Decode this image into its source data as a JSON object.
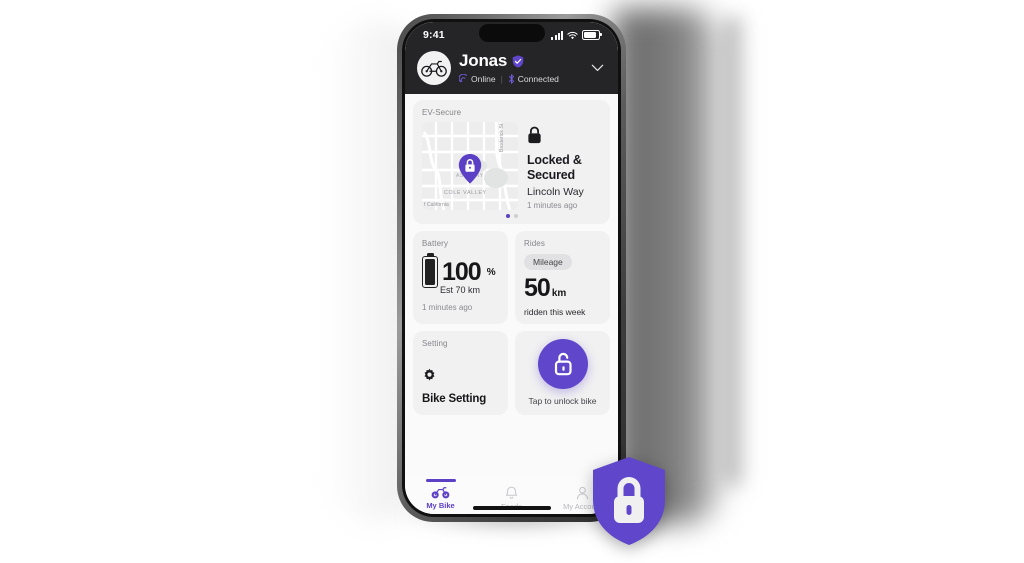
{
  "theme": {
    "accent": "#6046ca",
    "accent_dark": "#5b3fc4",
    "screen_bg": "#fafafa",
    "card_bg": "#f1f1f1",
    "header_bg": "#252528",
    "text_dark": "#17171a",
    "text_muted": "#8a8a90"
  },
  "status_bar": {
    "time": "9:41",
    "cellular_icon": "cellular-bars-icon",
    "wifi_icon": "wifi-icon",
    "battery_icon": "battery-icon"
  },
  "header": {
    "avatar_icon": "bicycle-avatar-icon",
    "user_name": "Jonas",
    "verified_icon": "verified-shield-icon",
    "connectivity": [
      {
        "icon": "signal-icon",
        "label": "Online"
      },
      {
        "icon": "bluetooth-icon",
        "label": "Connected"
      }
    ],
    "separator": "|",
    "chevron_icon": "chevron-down-icon"
  },
  "cards": {
    "map": {
      "label": "EV-Secure",
      "lock_icon": "padlock-closed-icon",
      "status_title": "Locked &\nSecured",
      "status_title_line1": "Locked &",
      "status_title_line2": "Secured",
      "street": "Lincoln Way",
      "updated": "1 minutes ago",
      "pin_icon": "map-pin-lock-icon",
      "map_labels": [
        "Broderick St",
        "COLE VALLEY",
        "ASHBURY",
        "f California"
      ],
      "carousel": {
        "total": 2,
        "active_index": 0
      }
    },
    "battery": {
      "label": "Battery",
      "battery_icon": "battery-full-icon",
      "value": "100",
      "unit": "%",
      "estimate": "Est 70 km",
      "updated": "1 minutes ago"
    },
    "rides": {
      "label": "Rides",
      "chip": "Mileage",
      "value": "50",
      "unit": "km",
      "caption": "ridden this week"
    },
    "setting": {
      "label": "Setting",
      "gear_icon": "gear-icon",
      "title": "Bike Setting"
    },
    "unlock": {
      "button_icon": "padlock-open-icon",
      "caption": "Tap to unlock bike"
    }
  },
  "tabbar": {
    "items": [
      {
        "icon": "bicycle-icon",
        "label": "My Bike",
        "active": true
      },
      {
        "icon": "bell-icon",
        "label": "Feeds",
        "active": false
      },
      {
        "icon": "user-icon",
        "label": "My Account",
        "active": false
      }
    ]
  },
  "overlay_badge": {
    "icon": "shield-lock-icon",
    "shield_color": "#6046ca",
    "lock_color": "#f0f0f0"
  }
}
